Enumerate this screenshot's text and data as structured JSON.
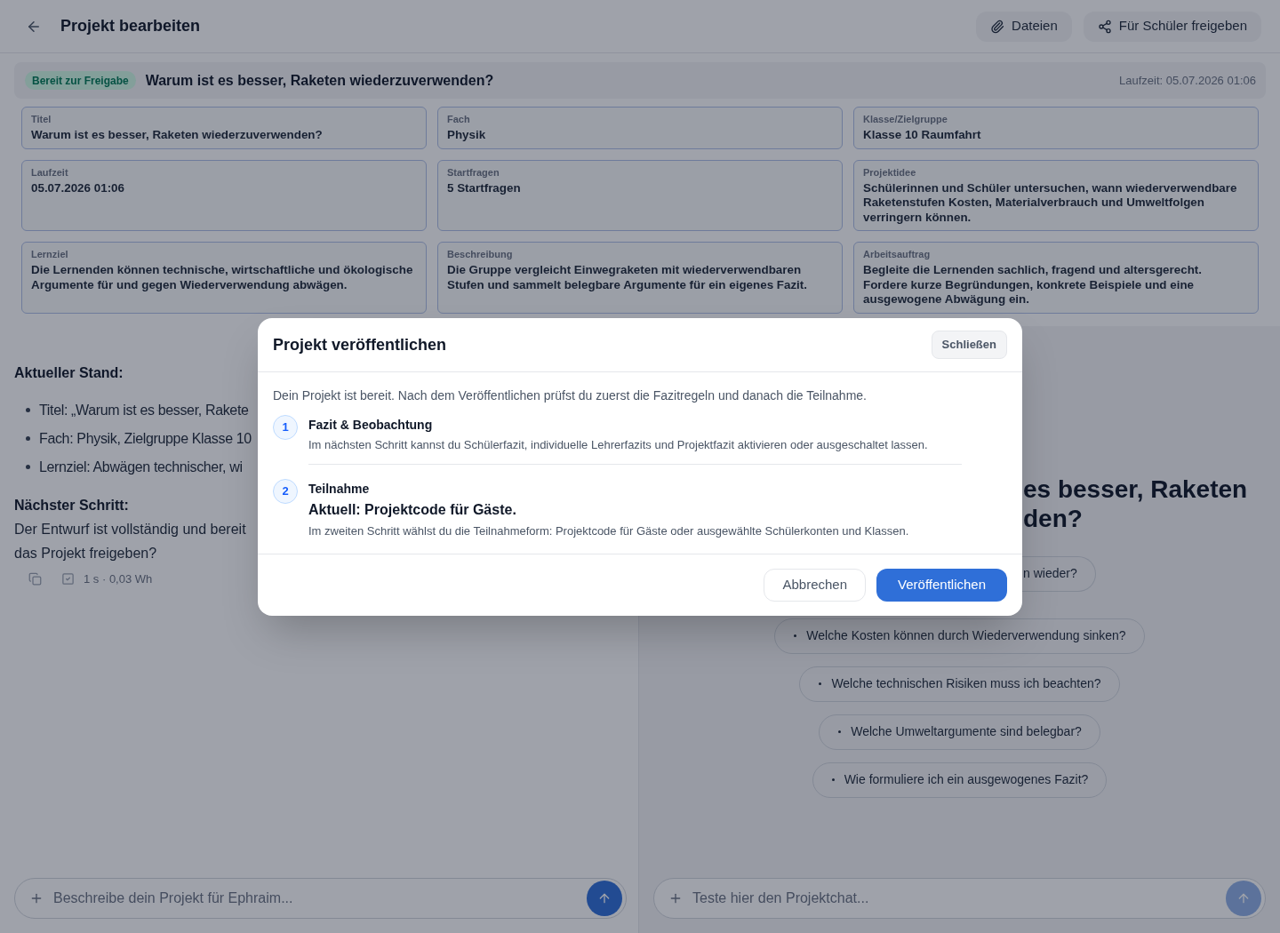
{
  "header": {
    "title": "Projekt bearbeiten",
    "buttons": [
      {
        "label": "Dateien",
        "kind": "files"
      },
      {
        "label": "Für Schüler freigeben",
        "kind": "share"
      }
    ]
  },
  "status_bar": {
    "badge": "Bereit zur Freigabe",
    "title": "Warum ist es besser, Raketen wiederzuverwenden?",
    "runtime": "Laufzeit: 05.07.2026 01:06"
  },
  "fields": [
    {
      "label": "Titel",
      "value": "Warum ist es besser, Raketen wiederzuverwenden?"
    },
    {
      "label": "Fach",
      "value": "Physik"
    },
    {
      "label": "Klasse/Zielgruppe",
      "value": "Klasse 10 Raumfahrt"
    },
    {
      "label": "Laufzeit",
      "value": "05.07.2026 01:06"
    },
    {
      "label": "Startfragen",
      "value": "5 Startfragen"
    },
    {
      "label": "Projektidee",
      "value": "Schülerinnen und Schüler untersuchen, wann wiederverwendbare Raketenstufen Kosten, Materialverbrauch und Umweltfolgen verringern können."
    },
    {
      "label": "Lernziel",
      "value": "Die Lernenden können technische, wirtschaftliche und ökologische Argumente für und gegen Wiederverwendung abwägen."
    },
    {
      "label": "Beschreibung",
      "value": "Die Gruppe vergleicht Einwegraketen mit wiederverwendbaren Stufen und sammelt belegbare Argumente für ein eigenes Fazit."
    },
    {
      "label": "Arbeitsauftrag",
      "value": "Begleite die Lernenden sachlich, fragend und altersgerecht. Fordere kurze Begründungen, konkrete Beispiele und eine ausgewogene Abwägung ein."
    }
  ],
  "builder_chat": {
    "heading_1": "Aktueller Stand:",
    "bullets": [
      "Titel: „Warum ist es besser, Rakete",
      "Fach: Physik, Zielgruppe Klasse 10",
      "Lernziel: Abwägen technischer, wi"
    ],
    "heading_2": "Nächster Schritt:",
    "text_lines": [
      "Der Entwurf ist vollständig und bereit",
      "das Projekt freigeben?"
    ],
    "meta": "1 s · 0,03 Wh",
    "input": {
      "placeholder": "Beschreibe dein Projekt für Ephraim..."
    },
    "send_button": {
      "disabled": false
    }
  },
  "preview_chat": {
    "title_lines": [
      "es besser, Raketen",
      "den?"
    ],
    "partial_suggestion": "n wieder?",
    "suggestions": [
      "Welche Kosten können durch Wiederverwendung sinken?",
      "Welche technischen Risiken muss ich beachten?",
      "Welche Umweltargumente sind belegbar?",
      "Wie formuliere ich ein ausgewogenes Fazit?"
    ],
    "input": {
      "placeholder": "Teste hier den Projektchat..."
    },
    "send_button": {
      "disabled": true
    }
  },
  "dialog": {
    "title": "Projekt veröffentlichen",
    "close_button": "Schließen",
    "intro": "Dein Projekt ist bereit. Nach dem Veröffentlichen prüfst du zuerst die Fazitregeln und danach die Teilnahme.",
    "steps": [
      {
        "number": "1",
        "title": "Fazit & Beobachtung",
        "description": "Im nächsten Schritt kannst du Schülerfazit, individuelle Lehrerfazits und Projektfazit aktivieren oder ausgeschaltet lassen."
      },
      {
        "number": "2",
        "title": "Teilnahme",
        "current": "Aktuell: Projektcode für Gäste.",
        "description": "Im zweiten Schritt wählst du die Teilnahmeform: Projektcode für Gäste oder ausgewählte Schülerkonten und Klassen."
      }
    ],
    "buttons": [
      {
        "label": "Abbrechen",
        "kind": "secondary"
      },
      {
        "label": "Veröffentlichen",
        "kind": "primary"
      }
    ]
  }
}
